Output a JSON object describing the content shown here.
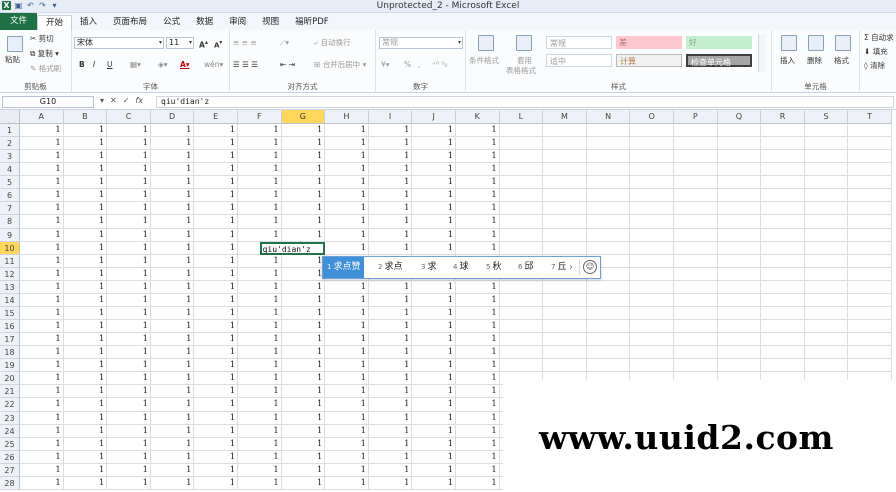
{
  "window": {
    "title": "Unprotected_2 - Microsoft Excel",
    "quick_access": [
      "excel-logo",
      "save-icon",
      "undo-icon",
      "redo-icon",
      "customize-icon"
    ]
  },
  "ribbon_tabs": [
    "文件",
    "开始",
    "插入",
    "页面布局",
    "公式",
    "数据",
    "审阅",
    "视图",
    "福昕PDF"
  ],
  "ribbon": {
    "clipboard": {
      "paste": "粘贴",
      "cut": "剪切",
      "copy": "复制",
      "format_painter": "格式刷",
      "label": "剪贴板"
    },
    "font": {
      "name": "宋体",
      "size": "11",
      "grow": "A",
      "shrink": "A",
      "bold": "B",
      "italic": "I",
      "underline": "U",
      "label": "字体",
      "phonetic": "wén"
    },
    "alignment": {
      "wrap": "自动换行",
      "merge": "合并后居中",
      "label": "对齐方式"
    },
    "number": {
      "format": "常规",
      "percent": "%",
      "comma": ",",
      "label": "数字"
    },
    "styles": {
      "conditional": "条件格式",
      "table": "套用",
      "table2": "表格格式",
      "normal": "常规",
      "bad": "差",
      "good": "好",
      "neutral": "适中",
      "calc": "计算",
      "check": "检查单元格",
      "label": "样式"
    },
    "cells": {
      "insert": "插入",
      "delete": "删除",
      "format": "格式",
      "label": "单元格"
    },
    "editing": {
      "autosum": "自动求",
      "fill": "填充",
      "clear": "清除"
    }
  },
  "formula_bar": {
    "name_box": "G10",
    "cancel": "✕",
    "enter": "✓",
    "fx": "fx",
    "content": "qiu'dian'z"
  },
  "columns": [
    "A",
    "B",
    "C",
    "D",
    "E",
    "F",
    "G",
    "H",
    "I",
    "J",
    "K",
    "L",
    "M",
    "N",
    "O",
    "P",
    "Q",
    "R",
    "S",
    "T"
  ],
  "selected_column": "G",
  "selected_row": 10,
  "rows": 28,
  "filled_columns": 11,
  "cell_value": "1",
  "active_cell_text": "qiu'dian'z",
  "ime": {
    "candidates": [
      {
        "num": "1",
        "text": "求点赞"
      },
      {
        "num": "2",
        "text": "求点"
      },
      {
        "num": "3",
        "text": "求"
      },
      {
        "num": "4",
        "text": "球"
      },
      {
        "num": "5",
        "text": "秋"
      },
      {
        "num": "6",
        "text": "邱"
      },
      {
        "num": "7",
        "text": "丘"
      }
    ],
    "next": "›",
    "emoji": "☺"
  },
  "watermark": "www.uuid2.com"
}
